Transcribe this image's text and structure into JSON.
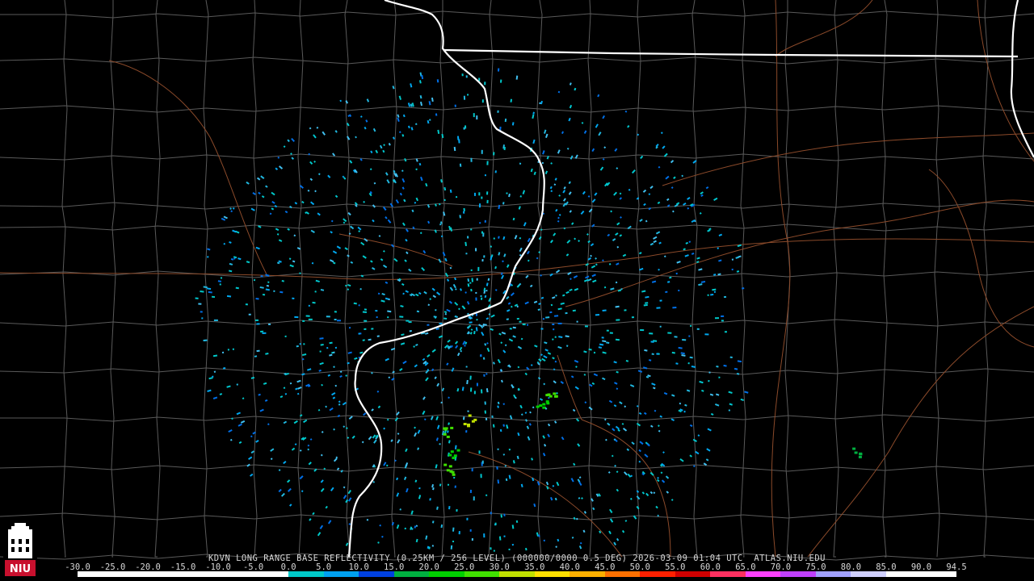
{
  "product": {
    "caption": "KDVN LONG RANGE BASE REFLECTIVITY (0.25KM / 256 LEVEL) (000000/0000 0.5 DEG) 2026-03-09 01:04 UTC  ATLAS.NIU.EDU"
  },
  "logo": {
    "text": "NIU"
  },
  "scale": {
    "labels": [
      "-30.0",
      "-25.0",
      "-20.0",
      "-15.0",
      "-10.0",
      "-5.0",
      "0.0",
      "5.0",
      "10.0",
      "15.0",
      "20.0",
      "25.0",
      "30.0",
      "35.0",
      "40.0",
      "45.0",
      "50.0",
      "55.0",
      "60.0",
      "65.0",
      "70.0",
      "75.0",
      "80.0",
      "85.0",
      "90.0",
      "94.5"
    ],
    "colors": [
      "#ffffff",
      "#ffffff",
      "#ffffff",
      "#ffffff",
      "#ffffff",
      "#ffffff",
      "#00c8c8",
      "#00a0f0",
      "#0040e0",
      "#00b040",
      "#00d000",
      "#40e000",
      "#c0e000",
      "#ffe000",
      "#ffb000",
      "#ff7000",
      "#ff2000",
      "#d00000",
      "#ff3060",
      "#ff40ff",
      "#c040ff",
      "#a0a0ff",
      "#d0d0ff",
      "#ffffff",
      "#ffffff"
    ]
  },
  "colors": {
    "background": "#000000",
    "county_lines": "#5a5a5a",
    "state_lines": "#ffffff",
    "highways": "#8b4a2a"
  }
}
